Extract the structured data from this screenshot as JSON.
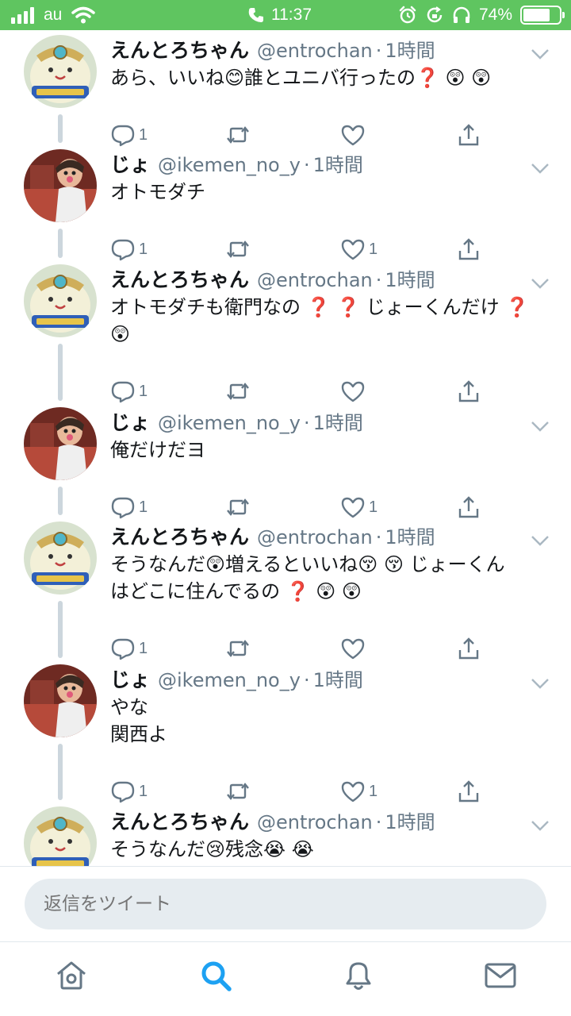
{
  "status_bar": {
    "carrier": "au",
    "time": "11:37",
    "battery_percent": "74%",
    "battery_level": 0.74
  },
  "colors": {
    "status_bar_bg": "#5fc560",
    "accent": "#1da1f2",
    "secondary_text": "#657786",
    "thread_line": "#ccd6dd"
  },
  "tweets": [
    {
      "name": "えんとろちゃん",
      "handle": "@entrochan",
      "separator": "·",
      "time": "1時間",
      "text": "あら、いいね😊誰とユニバ行ったの❓ 😲 😲",
      "reply_count": "1",
      "like_count": "",
      "avatar": "dragon-quest-slime-avatar"
    },
    {
      "name": "じょ",
      "handle": "@ikemen_no_y",
      "separator": "·",
      "time": "1時間",
      "text": "オトモダチ",
      "reply_count": "1",
      "like_count": "1",
      "avatar": "user-photo-avatar"
    },
    {
      "name": "えんとろちゃん",
      "handle": "@entrochan",
      "separator": "·",
      "time": "1時間",
      "text": "オトモダチも衛門なの ❓ ❓ じょーくんだけ ❓\n😲",
      "reply_count": "1",
      "like_count": "",
      "avatar": "dragon-quest-slime-avatar"
    },
    {
      "name": "じょ",
      "handle": "@ikemen_no_y",
      "separator": "·",
      "time": "1時間",
      "text": "俺だけだヨ",
      "reply_count": "1",
      "like_count": "1",
      "avatar": "user-photo-avatar"
    },
    {
      "name": "えんとろちゃん",
      "handle": "@entrochan",
      "separator": "·",
      "time": "1時間",
      "text": "そうなんだ😲増えるといいね😚 😚 じょーくん\nはどこに住んでるの ❓ 😲 😲",
      "reply_count": "1",
      "like_count": "",
      "avatar": "dragon-quest-slime-avatar"
    },
    {
      "name": "じょ",
      "handle": "@ikemen_no_y",
      "separator": "·",
      "time": "1時間",
      "text": "やな\n関西よ",
      "reply_count": "1",
      "like_count": "1",
      "avatar": "user-photo-avatar"
    },
    {
      "name": "えんとろちゃん",
      "handle": "@entrochan",
      "separator": "·",
      "time": "1時間",
      "text": "そうなんだ😢残念😭 😭",
      "reply_count": "",
      "like_count": "",
      "avatar": "dragon-quest-slime-avatar"
    }
  ],
  "reply_bar": {
    "placeholder": "返信をツイート"
  },
  "tab_bar": {
    "tabs": [
      "home-icon",
      "search-icon",
      "notifications-icon",
      "messages-icon"
    ],
    "active": "search-icon"
  }
}
